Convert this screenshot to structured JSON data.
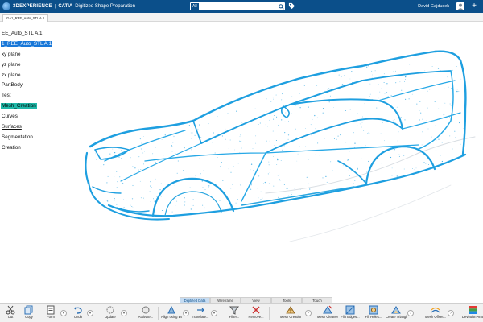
{
  "topbar": {
    "brand": "3DEXPERIENCE",
    "separator": "|",
    "app_name": "CATIA",
    "app_title": "Digitized Shape Preparation",
    "search_scope": "All",
    "search_placeholder": "",
    "user_name": "David Gajdusek"
  },
  "document_tab": "GA1_REE_Auto_STL A.1",
  "tree": {
    "items": [
      {
        "label": "EE_Auto_STL A.1",
        "state": "normal"
      },
      {
        "label": "1_REE_Auto_STL A.1",
        "state": "selected"
      },
      {
        "label": "xy plane",
        "state": "normal"
      },
      {
        "label": "yz plane",
        "state": "normal"
      },
      {
        "label": "zx plane",
        "state": "normal"
      },
      {
        "label": "PartBody",
        "state": "normal"
      },
      {
        "label": "Test",
        "state": "normal"
      },
      {
        "label": "Mesh_Creation",
        "state": "highlighted"
      },
      {
        "label": "Curves",
        "state": "normal"
      },
      {
        "label": "Surfaces",
        "state": "underlined"
      },
      {
        "label": "Segmentation",
        "state": "normal"
      },
      {
        "label": "Creation",
        "state": "normal"
      }
    ]
  },
  "action_tabs": [
    {
      "label": "Digitized Data",
      "active": true
    },
    {
      "label": "Wireframe",
      "active": false
    },
    {
      "label": "View",
      "active": false
    },
    {
      "label": "Tools",
      "active": false
    },
    {
      "label": "Touch",
      "active": false
    }
  ],
  "toolbar": {
    "cut": "Cut",
    "copy": "Copy",
    "form": "Form",
    "undo": "Undo",
    "update": "Update",
    "activate": "Activate...",
    "align": "Align using Be...",
    "translate": "Translate...",
    "filter": "Filter...",
    "remove": "Remove...",
    "mesh_creation": "Mesh Creation...",
    "mesh_cleaner": "Mesh Cleaner...",
    "flip_edges": "Flip Edges...",
    "fill_holes": "Fill Holes...",
    "create_triangle": "Create Triangle...",
    "mesh_offset": "Mesh Offset...",
    "deviation_analysis": "Deviation Analysis..."
  },
  "colors": {
    "topbar": "#0b4f8a",
    "point_cloud": "#1e9fe0",
    "tree_selected": "#1877d8",
    "tree_highlight": "#1fb8a8"
  },
  "icons": {
    "compass": "3dexperience-compass",
    "search": "magnifier",
    "tag": "tag",
    "user": "user-avatar",
    "add": "plus"
  }
}
